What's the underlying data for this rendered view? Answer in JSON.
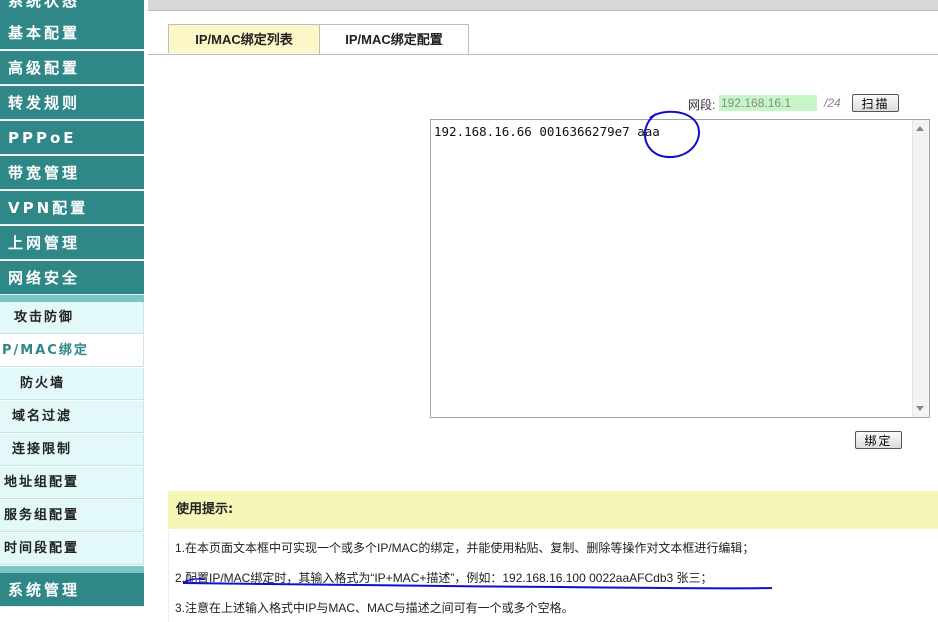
{
  "sidebar": {
    "main_items_top": [
      {
        "label": "系统状态"
      },
      {
        "label": "基本配置"
      },
      {
        "label": "高级配置"
      },
      {
        "label": "转发规则"
      },
      {
        "label": "PPPoE"
      },
      {
        "label": "带宽管理"
      },
      {
        "label": "VPN配置"
      },
      {
        "label": "上网管理"
      },
      {
        "label": "网络安全"
      }
    ],
    "sub_items": [
      {
        "label": "攻击防御"
      },
      {
        "label": "P/MAC绑定",
        "active": true
      },
      {
        "label": "防火墙"
      },
      {
        "label": "域名过滤"
      },
      {
        "label": "连接限制"
      },
      {
        "label": "地址组配置"
      },
      {
        "label": "服务组配置"
      },
      {
        "label": "时间段配置"
      }
    ],
    "main_items_bottom": [
      {
        "label": "系统管理"
      }
    ]
  },
  "tabs": [
    {
      "label": "IP/MAC绑定列表",
      "active": false
    },
    {
      "label": "IP/MAC绑定配置",
      "active": true
    }
  ],
  "segment": {
    "label": "网段:",
    "value": "192.168.16.1",
    "suffix": "/24",
    "scan_label": "扫描"
  },
  "binding": {
    "text": "192.168.16.66 0016366279e7 aaa"
  },
  "bind_label": "绑定",
  "tips": {
    "title": "使用提示:",
    "lines": [
      "1.在本页面文本框中可实现一个或多个IP/MAC的绑定，并能使用粘贴、复制、删除等操作对文本框进行编辑；",
      "2.配置IP/MAC绑定时，其输入格式为“IP+MAC+描述”，例如：192.168.16.100 0022aaAFCdb3 张三；",
      "3.注意在上述输入格式中IP与MAC、MAC与描述之间可有一个或多个空格。"
    ]
  },
  "colors": {
    "sidebar_bg": "#2f8787",
    "sub_bg": "#e3f8f9",
    "tab_inactive": "#fdf6c6",
    "tips_bg": "#f5f7b8",
    "annotation": "#1111cc"
  }
}
